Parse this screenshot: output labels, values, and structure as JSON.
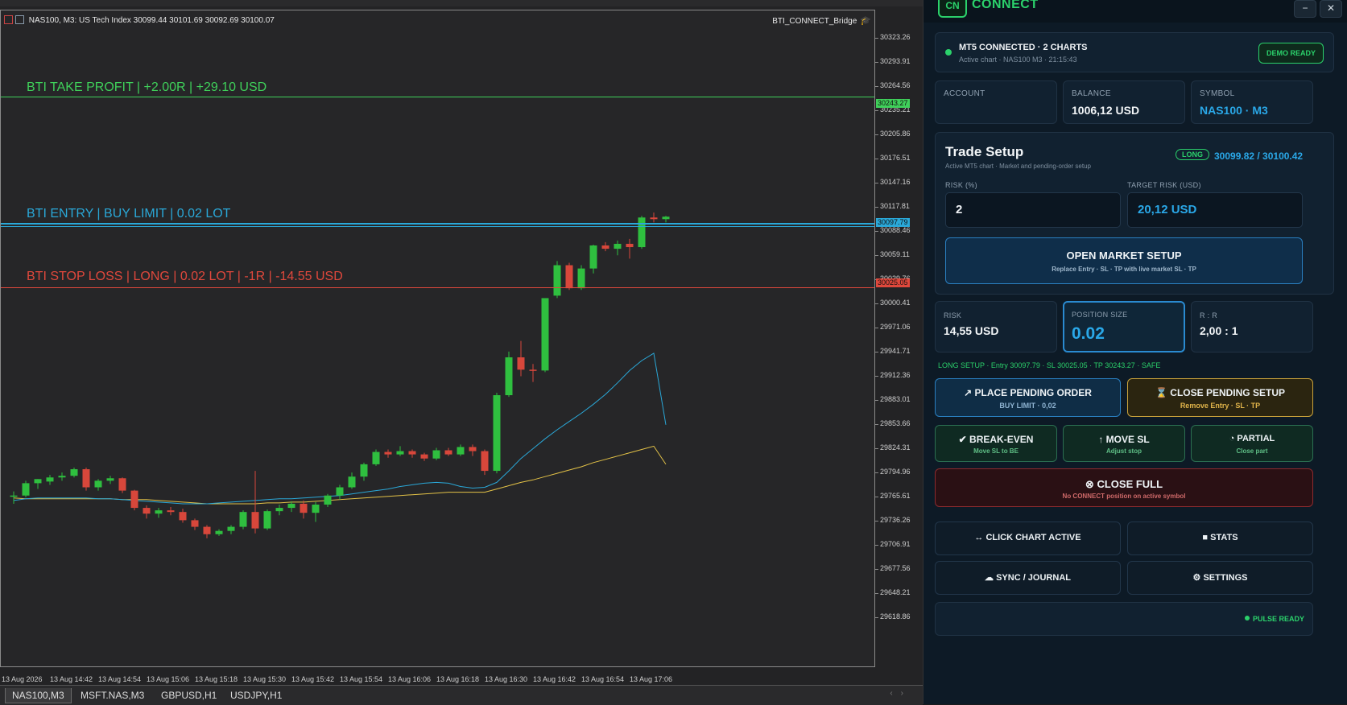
{
  "chart": {
    "header": "NAS100, M3:  US Tech Index  30099.44 30101.69 30092.69 30100.07",
    "bridge": "BTI_CONNECT_Bridge",
    "bridge_icon": "graduation-cap-icon",
    "tp_label": "BTI TAKE PROFIT | +2.00R | +29.10 USD",
    "entry_label": "BTI ENTRY | BUY LIMIT | 0.02 LOT",
    "sl_label": "BTI STOP LOSS | LONG | 0.02 LOT | -1R | -14.55 USD",
    "price_ticks": [
      "30323.26",
      "30293.91",
      "30264.56",
      "30235.21",
      "30205.86",
      "30176.51",
      "30147.16",
      "30117.81",
      "30088.46",
      "30059.11",
      "30029.76",
      "30000.41",
      "29971.06",
      "29941.71",
      "29912.36",
      "29883.01",
      "29853.66",
      "29824.31",
      "29794.96",
      "29765.61",
      "29736.26",
      "29706.91",
      "29677.56",
      "29648.21",
      "29618.86"
    ],
    "badges": {
      "tp": "30243.27",
      "entry": "30097.79",
      "sl": "30025.05"
    },
    "time_ticks": [
      "13 Aug 2026",
      "13 Aug 14:42",
      "13 Aug 14:54",
      "13 Aug 15:06",
      "13 Aug 15:18",
      "13 Aug 15:30",
      "13 Aug 15:42",
      "13 Aug 15:54",
      "13 Aug 16:06",
      "13 Aug 16:18",
      "13 Aug 16:30",
      "13 Aug 16:42",
      "13 Aug 16:54",
      "13 Aug 17:06"
    ],
    "colors": {
      "bull": "#2fbf3f",
      "bear": "#d8473b",
      "tp": "#3fd05a",
      "entry": "#2aa8d8",
      "sl": "#e0483c",
      "ma_fast": "#2aa8d8",
      "ma_slow": "#e3c247"
    },
    "candles": [
      {
        "o": 29760,
        "h": 29765,
        "l": 29750,
        "c": 29760
      },
      {
        "o": 29760,
        "h": 29778,
        "l": 29758,
        "c": 29775
      },
      {
        "o": 29775,
        "h": 29780,
        "l": 29768,
        "c": 29780
      },
      {
        "o": 29777,
        "h": 29785,
        "l": 29773,
        "c": 29782
      },
      {
        "o": 29782,
        "h": 29788,
        "l": 29778,
        "c": 29784
      },
      {
        "o": 29784,
        "h": 29794,
        "l": 29782,
        "c": 29792
      },
      {
        "o": 29792,
        "h": 29794,
        "l": 29766,
        "c": 29770
      },
      {
        "o": 29770,
        "h": 29780,
        "l": 29766,
        "c": 29778
      },
      {
        "o": 29778,
        "h": 29784,
        "l": 29774,
        "c": 29781
      },
      {
        "o": 29781,
        "h": 29782,
        "l": 29763,
        "c": 29766
      },
      {
        "o": 29766,
        "h": 29767,
        "l": 29742,
        "c": 29745
      },
      {
        "o": 29745,
        "h": 29748,
        "l": 29732,
        "c": 29738
      },
      {
        "o": 29738,
        "h": 29745,
        "l": 29733,
        "c": 29742
      },
      {
        "o": 29742,
        "h": 29746,
        "l": 29736,
        "c": 29740
      },
      {
        "o": 29740,
        "h": 29744,
        "l": 29727,
        "c": 29730
      },
      {
        "o": 29730,
        "h": 29732,
        "l": 29718,
        "c": 29722
      },
      {
        "o": 29722,
        "h": 29724,
        "l": 29708,
        "c": 29713
      },
      {
        "o": 29713,
        "h": 29719,
        "l": 29711,
        "c": 29717
      },
      {
        "o": 29717,
        "h": 29724,
        "l": 29713,
        "c": 29722
      },
      {
        "o": 29722,
        "h": 29742,
        "l": 29719,
        "c": 29740
      },
      {
        "o": 29740,
        "h": 29790,
        "l": 29714,
        "c": 29720
      },
      {
        "o": 29720,
        "h": 29743,
        "l": 29718,
        "c": 29741
      },
      {
        "o": 29741,
        "h": 29749,
        "l": 29736,
        "c": 29745
      },
      {
        "o": 29745,
        "h": 29753,
        "l": 29740,
        "c": 29750
      },
      {
        "o": 29750,
        "h": 29754,
        "l": 29732,
        "c": 29739
      },
      {
        "o": 29739,
        "h": 29752,
        "l": 29728,
        "c": 29749
      },
      {
        "o": 29749,
        "h": 29762,
        "l": 29746,
        "c": 29760
      },
      {
        "o": 29760,
        "h": 29773,
        "l": 29755,
        "c": 29770
      },
      {
        "o": 29770,
        "h": 29788,
        "l": 29768,
        "c": 29783
      },
      {
        "o": 29783,
        "h": 29800,
        "l": 29778,
        "c": 29798
      },
      {
        "o": 29798,
        "h": 29816,
        "l": 29796,
        "c": 29813
      },
      {
        "o": 29813,
        "h": 29816,
        "l": 29806,
        "c": 29810
      },
      {
        "o": 29810,
        "h": 29820,
        "l": 29808,
        "c": 29814
      },
      {
        "o": 29814,
        "h": 29816,
        "l": 29806,
        "c": 29810
      },
      {
        "o": 29810,
        "h": 29812,
        "l": 29802,
        "c": 29805
      },
      {
        "o": 29805,
        "h": 29818,
        "l": 29803,
        "c": 29815
      },
      {
        "o": 29815,
        "h": 29818,
        "l": 29808,
        "c": 29810
      },
      {
        "o": 29810,
        "h": 29822,
        "l": 29808,
        "c": 29819
      },
      {
        "o": 29819,
        "h": 29822,
        "l": 29808,
        "c": 29814
      },
      {
        "o": 29814,
        "h": 29816,
        "l": 29785,
        "c": 29790
      },
      {
        "o": 29790,
        "h": 29885,
        "l": 29787,
        "c": 29882
      },
      {
        "o": 29882,
        "h": 29935,
        "l": 29880,
        "c": 29928
      },
      {
        "o": 29928,
        "h": 29948,
        "l": 29905,
        "c": 29913
      },
      {
        "o": 29913,
        "h": 29920,
        "l": 29898,
        "c": 29912
      },
      {
        "o": 29912,
        "h": 29980,
        "l": 29910,
        "c": 30000
      },
      {
        "o": 30003,
        "h": 30045,
        "l": 30000,
        "c": 30040
      },
      {
        "o": 30040,
        "h": 30043,
        "l": 30010,
        "c": 30012
      },
      {
        "o": 30012,
        "h": 30040,
        "l": 30010,
        "c": 30036
      },
      {
        "o": 30036,
        "h": 30065,
        "l": 30030,
        "c": 30064
      },
      {
        "o": 30064,
        "h": 30068,
        "l": 30057,
        "c": 30060
      },
      {
        "o": 30060,
        "h": 30070,
        "l": 30052,
        "c": 30066
      },
      {
        "o": 30066,
        "h": 30072,
        "l": 30048,
        "c": 30062
      },
      {
        "o": 30062,
        "h": 30100,
        "l": 30060,
        "c": 30098
      },
      {
        "o": 30098,
        "h": 30104,
        "l": 30092,
        "c": 30096
      },
      {
        "o": 30096,
        "h": 30100,
        "l": 30092,
        "c": 30099
      }
    ],
    "ma_fast": [
      29754,
      29756,
      29757,
      29757,
      29757,
      29757,
      29757,
      29756,
      29756,
      29755,
      29754,
      29753,
      29752,
      29751,
      29750,
      29750,
      29750,
      29751,
      29752,
      29753,
      29754,
      29755,
      29756,
      29756,
      29757,
      29758,
      29759,
      29760,
      29762,
      29764,
      29766,
      29768,
      29771,
      29773,
      29775,
      29776,
      29775,
      29771,
      29769,
      29770,
      29776,
      29790,
      29805,
      29817,
      29829,
      29840,
      29850,
      29860,
      29871,
      29883,
      29897,
      29912,
      29924,
      29933,
      29846
    ],
    "ma_slow": [
      29757,
      29756,
      29756,
      29756,
      29756,
      29756,
      29756,
      29756,
      29756,
      29755,
      29755,
      29755,
      29754,
      29753,
      29752,
      29751,
      29750,
      29750,
      29750,
      29750,
      29750,
      29751,
      29751,
      29752,
      29752,
      29753,
      29754,
      29755,
      29756,
      29757,
      29758,
      29759,
      29760,
      29761,
      29762,
      29763,
      29764,
      29764,
      29764,
      29764,
      29768,
      29772,
      29776,
      29779,
      29783,
      29787,
      29791,
      29795,
      29800,
      29804,
      29808,
      29812,
      29816,
      29820,
      29798
    ]
  },
  "tabs": [
    "NAS100,M3",
    "MSFT.NAS,M3",
    "GBPUSD,H1",
    "USDJPY,H1"
  ],
  "panel": {
    "logo": "CN",
    "title": "CONNECT",
    "win_min": "−",
    "win_close": "✕",
    "status": {
      "title": "MT5 CONNECTED · 2 CHARTS",
      "subtitle": "Active chart · NAS100 M3 · 21:15:43",
      "badge": "DEMO READY"
    },
    "account": {
      "label": "ACCOUNT",
      "value": ""
    },
    "balance": {
      "label": "BALANCE",
      "value": "1006,12 USD"
    },
    "symbol": {
      "label": "SYMBOL",
      "value": "NAS100 · M3"
    },
    "setup": {
      "title": "Trade Setup",
      "subtitle": "Active MT5 chart · Market and pending-order setup",
      "direction": "LONG",
      "quote": "30099.82 / 30100.42",
      "risk_label": "RISK (%)",
      "risk_value": "2",
      "target_label": "TARGET RISK (USD)",
      "target_value": "20,12 USD",
      "open_market": "OPEN MARKET SETUP",
      "open_market_sub": "Replace Entry · SL · TP with live market SL · TP"
    },
    "stats": {
      "risk_label": "RISK",
      "risk_value": "14,55 USD",
      "pos_label": "POSITION SIZE",
      "pos_value": "0.02",
      "rr_label": "R : R",
      "rr_value": "2,00 : 1"
    },
    "summary": "LONG SETUP · Entry 30097.79 · SL 30025.05 · TP 30243.27 · SAFE",
    "buttons": {
      "place": {
        "label": "PLACE PENDING ORDER",
        "sub": "BUY LIMIT · 0,02",
        "icon": "↗"
      },
      "close_pending": {
        "label": "CLOSE PENDING SETUP",
        "sub": "Remove Entry · SL · TP",
        "icon": "⌛"
      },
      "breakeven": {
        "label": "BREAK-EVEN",
        "sub": "Move SL to BE",
        "icon": "✔"
      },
      "move_sl": {
        "label": "MOVE SL",
        "sub": "Adjust stop",
        "icon": "↑"
      },
      "partial": {
        "label": "PARTIAL",
        "sub": "Close part",
        "icon": "◔"
      },
      "close_full": {
        "label": "CLOSE FULL",
        "sub": "No CONNECT position on active symbol",
        "icon": "⊗"
      },
      "click_chart": {
        "label": "CLICK CHART ACTIVE",
        "icon": "↔"
      },
      "stats": {
        "label": "STATS",
        "icon": "■"
      },
      "sync": {
        "label": "SYNC / JOURNAL",
        "icon": "☁"
      },
      "settings": {
        "label": "SETTINGS",
        "icon": "⚙"
      }
    },
    "pulse": "PULSE READY"
  }
}
